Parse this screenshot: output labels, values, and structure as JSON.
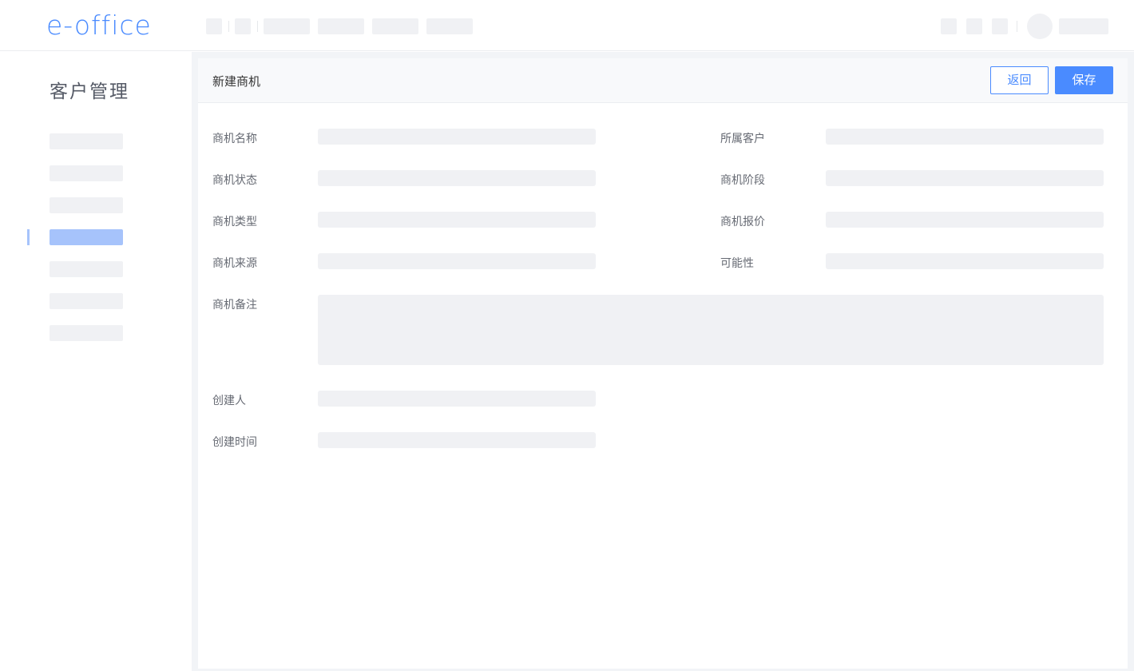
{
  "header": {
    "logo": "e-office"
  },
  "sidebar": {
    "title": "客户管理",
    "active_index": 3
  },
  "panel": {
    "title": "新建商机",
    "back_label": "返回",
    "save_label": "保存"
  },
  "form": {
    "name_label": "商机名称",
    "customer_label": "所属客户",
    "status_label": "商机状态",
    "stage_label": "商机阶段",
    "type_label": "商机类型",
    "quote_label": "商机报价",
    "source_label": "商机来源",
    "probability_label": "可能性",
    "remark_label": "商机备注",
    "creator_label": "创建人",
    "created_time_label": "创建时间"
  },
  "colors": {
    "accent": "#4a8bff",
    "active_item": "#a6c3fb",
    "placeholder": "#f0f1f4"
  }
}
